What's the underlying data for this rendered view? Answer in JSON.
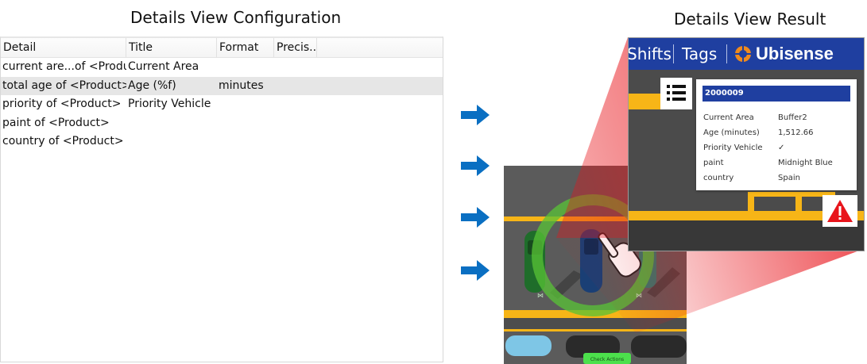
{
  "configuration": {
    "heading": "Details View Configuration",
    "columns": [
      "Detail",
      "Title",
      "Format",
      "Precis..."
    ],
    "rows": [
      {
        "detail": "current are...of <Product>",
        "title": "Current Area",
        "format": "",
        "precision": ""
      },
      {
        "detail": "total age of <Product>",
        "title": "Age (%f)",
        "format": "minutes",
        "precision": ""
      },
      {
        "detail": "priority of <Product>",
        "title": "Priority Vehicle",
        "format": "",
        "precision": ""
      },
      {
        "detail": "paint of <Product>",
        "title": "",
        "format": "",
        "precision": ""
      },
      {
        "detail": "country of <Product>",
        "title": "",
        "format": "",
        "precision": ""
      }
    ],
    "selected_row": 1
  },
  "result": {
    "heading": "Details View Result",
    "nav": {
      "items": [
        "Shifts",
        "Tags"
      ],
      "brand": "Ubisense"
    },
    "card": {
      "id": "2000009",
      "rows": [
        {
          "label": "Current Area",
          "value": "Buffer2"
        },
        {
          "label": "Age (minutes)",
          "value": "1,512.66"
        },
        {
          "label": "Priority Vehicle",
          "value": "✓"
        },
        {
          "label": "paint",
          "value": "Midnight Blue"
        },
        {
          "label": "country",
          "value": "Spain"
        }
      ]
    }
  },
  "game_view": {
    "label": "Check Actions"
  },
  "colors": {
    "brand_blue": "#1f3fa0",
    "arrow_blue": "#0a6fc2",
    "callout_red": "#e8141b",
    "ring_green": "#58c336",
    "lane_yellow": "#f7b517",
    "asphalt": "#5b5b5b",
    "brand_orange": "#f08a1c"
  },
  "icons": [
    "arrow-right-icon",
    "list-icon",
    "warning-icon",
    "hand-pointer-icon",
    "ubisense-logo-icon",
    "checkmark-icon"
  ]
}
